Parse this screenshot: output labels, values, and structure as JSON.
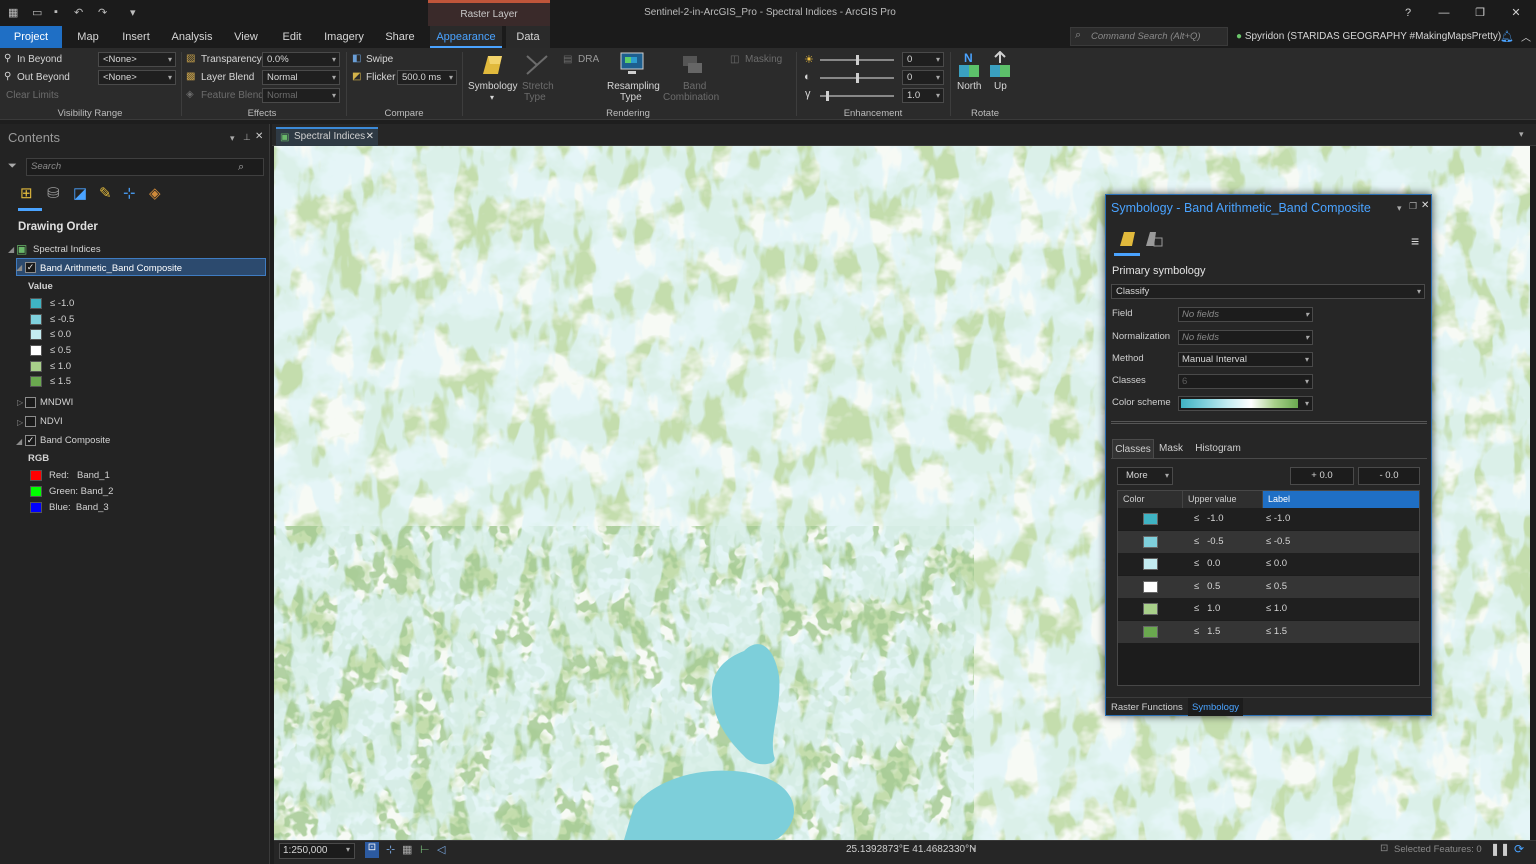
{
  "window": {
    "title": "Sentinel-2-in-ArcGIS_Pro - Spectral Indices - ArcGIS Pro",
    "context_band": "Raster Layer",
    "help_icon": "?",
    "minimize_icon": "—",
    "maximize_icon": "❐",
    "close_icon": "✕"
  },
  "tabs": [
    "Project",
    "Map",
    "Insert",
    "Analysis",
    "View",
    "Edit",
    "Imagery",
    "Share",
    "Appearance",
    "Data"
  ],
  "command_search": {
    "placeholder": "Command Search (Alt+Q)"
  },
  "user": "Spyridon (STARIDAS GEOGRAPHY #MakingMapsPretty)",
  "ribbon": {
    "visibility_range": {
      "in_beyond": "In Beyond",
      "out_beyond": "Out Beyond",
      "clear_limits": "Clear Limits",
      "in_value": "<None>",
      "out_value": "<None>",
      "label": "Visibility Range"
    },
    "effects": {
      "transparency": "Transparency",
      "transparency_value": "0.0%",
      "layer_blend": "Layer Blend",
      "layer_blend_value": "Normal",
      "feature_blend": "Feature Blend",
      "feature_blend_value": "Normal",
      "label": "Effects"
    },
    "compare": {
      "swipe": "Swipe",
      "flicker": "Flicker",
      "flicker_value": "500.0",
      "flicker_unit": "ms",
      "label": "Compare"
    },
    "rendering": {
      "symbology": "Symbology",
      "stretch": "Stretch",
      "stretch_type": "Type",
      "dra": "DRA",
      "resampling": "Resampling",
      "resampling_type": "Type",
      "band": "Band",
      "band_combination": "Combination",
      "masking": "Masking",
      "label": "Rendering"
    },
    "enhancement": {
      "brightness": "0",
      "contrast": "0",
      "gamma": "1.0",
      "gamma_symbol": "γ",
      "label": "Enhancement"
    },
    "rotate": {
      "north": "North",
      "up": "Up",
      "label": "Rotate"
    }
  },
  "contents": {
    "title": "Contents",
    "search_placeholder": "Search",
    "drawing_order": "Drawing Order",
    "map_name": "Spectral Indices",
    "layer1": {
      "name": "Band Arithmetic_Band Composite",
      "legend_title": "Value",
      "classes": [
        {
          "label": "≤  -1.0",
          "color": "#3fb3c3"
        },
        {
          "label": "≤  -0.5",
          "color": "#7fd0dc"
        },
        {
          "label": "≤  0.0",
          "color": "#c4ecf1"
        },
        {
          "label": "≤  0.5",
          "color": "#ffffff"
        },
        {
          "label": "≤  1.0",
          "color": "#a8cf8a"
        },
        {
          "label": "≤  1.5",
          "color": "#6aa84f"
        }
      ]
    },
    "layer2": "MNDWI",
    "layer3": "NDVI",
    "layer4": {
      "name": "Band Composite",
      "legend_title": "RGB",
      "bands": [
        {
          "label": "Red:   Band_1",
          "color": "#ff0000"
        },
        {
          "label": "Green: Band_2",
          "color": "#00ff00"
        },
        {
          "label": "Blue:  Band_3",
          "color": "#0000ff"
        }
      ]
    }
  },
  "map": {
    "tab": "Spectral Indices",
    "scale": "1:250,000",
    "coordinates": "25.1392873°E 41.4682330°N",
    "selected_features": "Selected Features: 0"
  },
  "symbology": {
    "title": "Symbology - Band Arithmetic_Band Composite",
    "primary": "Primary symbology",
    "renderer": "Classify",
    "field_label": "Field",
    "field_value": "No fields",
    "normalization_label": "Normalization",
    "normalization_value": "No fields",
    "method_label": "Method",
    "method_value": "Manual Interval",
    "classes_label": "Classes",
    "classes_value": "6",
    "color_scheme_label": "Color scheme",
    "subtabs": [
      "Classes",
      "Mask",
      "Histogram"
    ],
    "more": "More",
    "plus": "+ 0.0",
    "minus": "- 0.0",
    "columns": [
      "Color",
      "Upper value",
      "Label"
    ],
    "rows": [
      {
        "color": "#3fb3c3",
        "upper": "≤   -1.0",
        "label": "≤ -1.0"
      },
      {
        "color": "#7fd0dc",
        "upper": "≤   -0.5",
        "label": "≤ -0.5"
      },
      {
        "color": "#c4ecf1",
        "upper": "≤   0.0",
        "label": "≤ 0.0"
      },
      {
        "color": "#ffffff",
        "upper": "≤   0.5",
        "label": "≤ 0.5"
      },
      {
        "color": "#a8cf8a",
        "upper": "≤   1.0",
        "label": "≤ 1.0"
      },
      {
        "color": "#6aa84f",
        "upper": "≤   1.5",
        "label": "≤ 1.5"
      }
    ],
    "footer_tabs": [
      "Raster Functions",
      "Symbology"
    ]
  }
}
